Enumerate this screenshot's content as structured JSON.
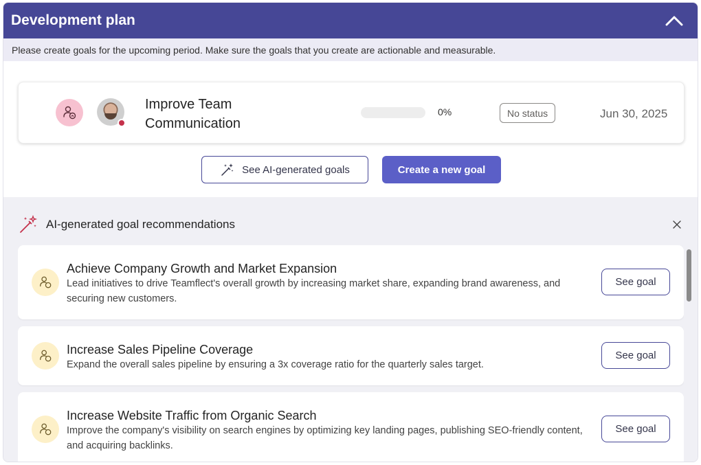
{
  "header": {
    "title": "Development plan"
  },
  "subtitle": "Please create goals for the upcoming period. Make sure the goals that you create are actionable and measurable.",
  "goal": {
    "title": "Improve Team Communication",
    "progress": 0,
    "progress_label": "0%",
    "status": "No status",
    "due_date": "Jun 30, 2025"
  },
  "buttons": {
    "ai_goals": "See AI-generated goals",
    "create_goal": "Create a new goal"
  },
  "ai_section": {
    "title": "AI-generated goal recommendations",
    "items": [
      {
        "title": "Achieve Company Growth and Market Expansion",
        "description": "Lead initiatives to drive Teamflect's overall growth by increasing market share, expanding brand awareness, and securing new customers.",
        "action": "See goal"
      },
      {
        "title": "Increase Sales Pipeline Coverage",
        "description": "Expand the overall sales pipeline by ensuring a 3x coverage ratio for the quarterly sales target.",
        "action": "See goal"
      },
      {
        "title": "Increase Website Traffic from Organic Search",
        "description": "Improve the company's visibility on search engines by optimizing key landing pages, publishing SEO-friendly content, and acquiring backlinks.",
        "action": "See goal"
      }
    ]
  },
  "colors": {
    "header_bg": "#464796",
    "primary": "#5b5fc7",
    "goal_icon_bg": "#f7c1d0",
    "rec_icon_bg": "#fdf0c8",
    "presence": "#c4314b",
    "ai_icon": "#c4314b"
  },
  "icons": {
    "collapse": "chevron-up-icon",
    "goal_type": "person-growth-icon",
    "ai": "magic-wand-icon",
    "close": "close-icon"
  }
}
